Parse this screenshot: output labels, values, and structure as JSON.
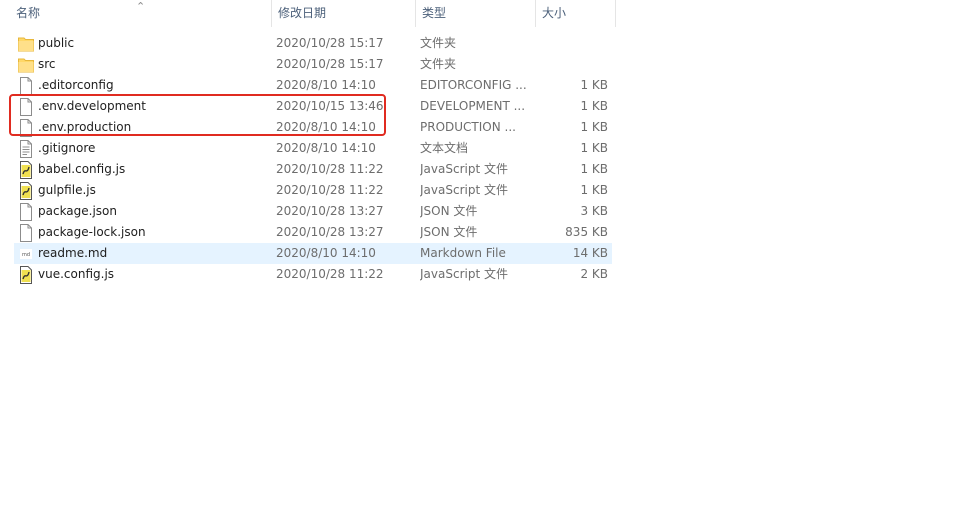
{
  "columns": {
    "name": "名称",
    "date": "修改日期",
    "type": "类型",
    "size": "大小"
  },
  "sort_indicator_icon": "sort-up-icon",
  "files": [
    {
      "name": "public",
      "date": "2020/10/28 15:17",
      "type": "文件夹",
      "size": "",
      "icon": "folder-icon"
    },
    {
      "name": "src",
      "date": "2020/10/28 15:17",
      "type": "文件夹",
      "size": "",
      "icon": "folder-icon"
    },
    {
      "name": ".editorconfig",
      "date": "2020/8/10 14:10",
      "type": "EDITORCONFIG ...",
      "size": "1 KB",
      "icon": "file-icon"
    },
    {
      "name": ".env.development",
      "date": "2020/10/15 13:46",
      "type": "DEVELOPMENT ...",
      "size": "1 KB",
      "icon": "file-icon"
    },
    {
      "name": ".env.production",
      "date": "2020/8/10 14:10",
      "type": "PRODUCTION ...",
      "size": "1 KB",
      "icon": "file-icon"
    },
    {
      "name": ".gitignore",
      "date": "2020/8/10 14:10",
      "type": "文本文档",
      "size": "1 KB",
      "icon": "text-file-icon"
    },
    {
      "name": "babel.config.js",
      "date": "2020/10/28 11:22",
      "type": "JavaScript 文件",
      "size": "1 KB",
      "icon": "js-file-icon"
    },
    {
      "name": "gulpfile.js",
      "date": "2020/10/28 11:22",
      "type": "JavaScript 文件",
      "size": "1 KB",
      "icon": "js-file-icon"
    },
    {
      "name": "package.json",
      "date": "2020/10/28 13:27",
      "type": "JSON 文件",
      "size": "3 KB",
      "icon": "file-icon"
    },
    {
      "name": "package-lock.json",
      "date": "2020/10/28 13:27",
      "type": "JSON 文件",
      "size": "835 KB",
      "icon": "file-icon"
    },
    {
      "name": "readme.md",
      "date": "2020/8/10 14:10",
      "type": "Markdown File",
      "size": "14 KB",
      "icon": "markdown-file-icon"
    },
    {
      "name": "vue.config.js",
      "date": "2020/10/28 11:22",
      "type": "JavaScript 文件",
      "size": "2 KB",
      "icon": "js-file-icon"
    }
  ],
  "hovered_row": "readme.md",
  "colors": {
    "highlight_box": "#e02b20",
    "hover_row": "#e5f3ff",
    "folder": "#ffd868",
    "header_text": "#4c607a"
  }
}
